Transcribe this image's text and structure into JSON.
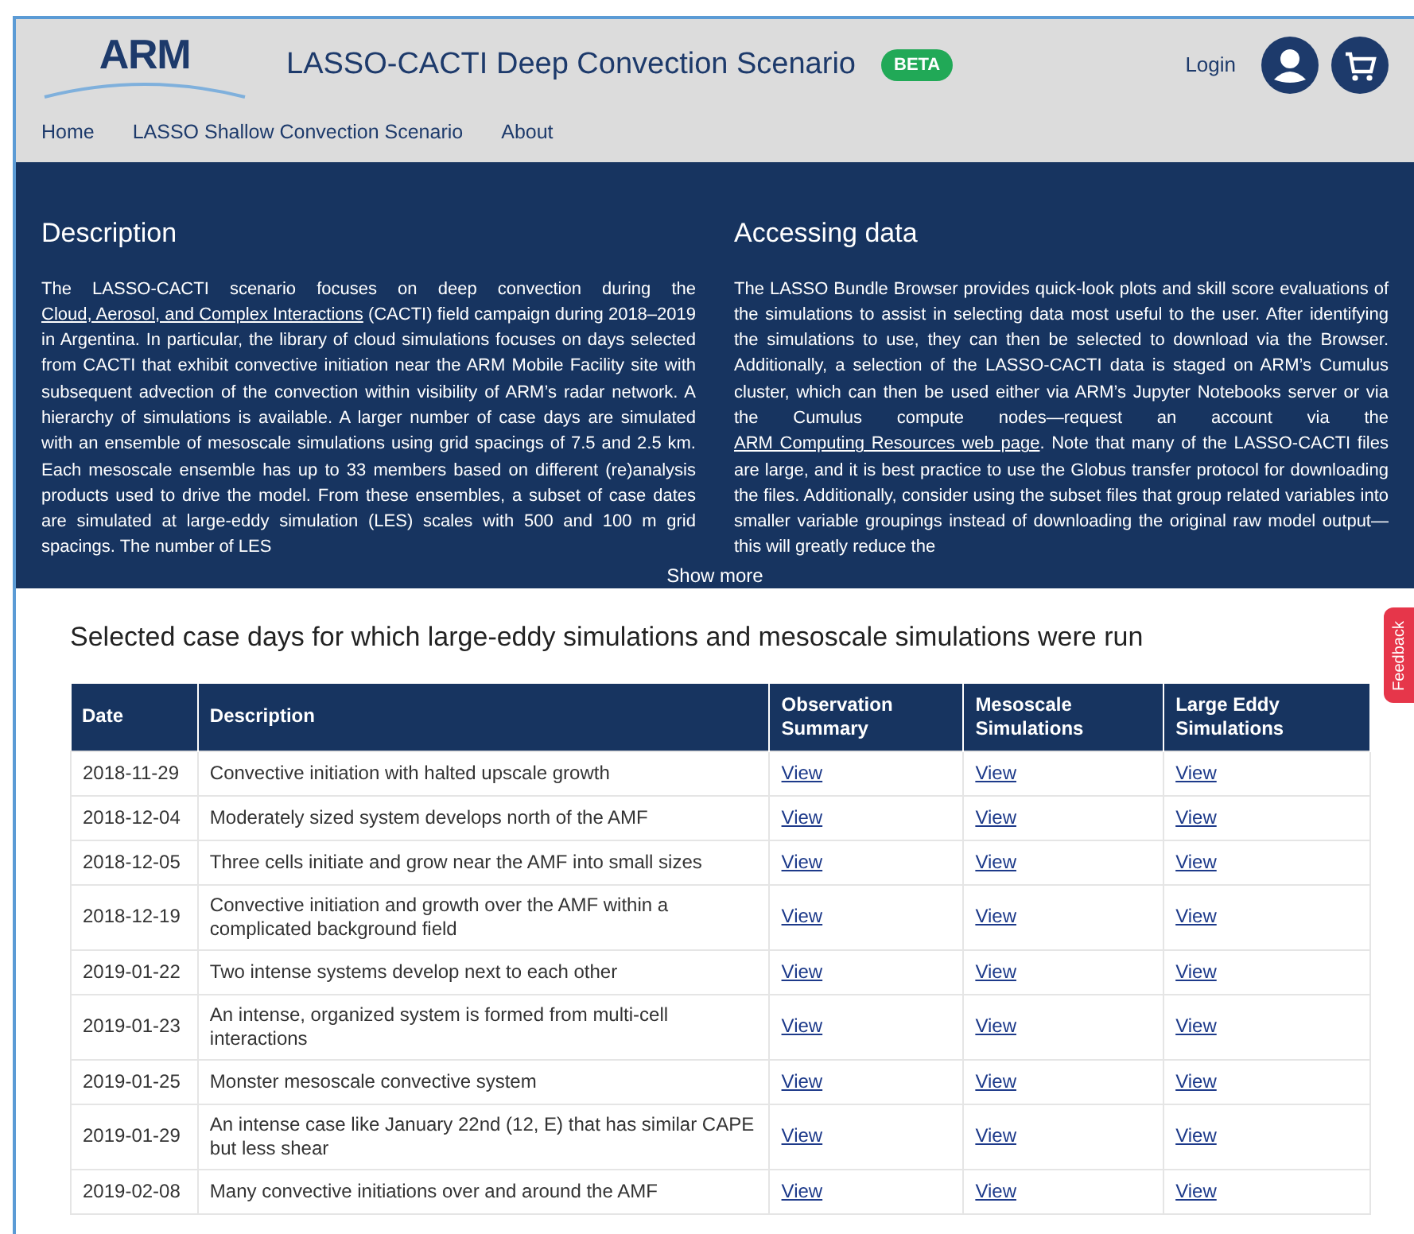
{
  "header": {
    "logo": "ARM",
    "title": "LASSO-CACTI Deep Convection Scenario",
    "badge": "BETA",
    "login": "Login"
  },
  "nav": [
    {
      "label": "Home"
    },
    {
      "label": "LASSO Shallow Convection Scenario"
    },
    {
      "label": "About"
    }
  ],
  "sections": [
    {
      "heading": "Description",
      "parts": [
        {
          "kind": "text",
          "text": "The LASSO-CACTI scenario focuses on deep convection during the"
        },
        {
          "kind": "link",
          "text": "Cloud, Aerosol, and Complex Interactions"
        },
        {
          "kind": "text",
          "text": "(CACTI) field campaign during 2018–2019 in Argentina. In particular, the library of cloud simulations focuses on days selected from CACTI that exhibit convective initiation near the ARM Mobile Facility site with subsequent advection of the convection within visibility of ARM’s radar network. A hierarchy of simulations is available. A larger number of case days are simulated with an ensemble of mesoscale simulations using grid spacings of 7.5 and 2.5 km. Each mesoscale ensemble has up to 33 members based on different (re)analysis products used to drive the model. From these ensembles, a subset of case dates are simulated at large-eddy simulation (LES) scales with 500 and 100 m grid spacings. The number of LES"
        }
      ]
    },
    {
      "heading": "Accessing data",
      "parts": [
        {
          "kind": "text",
          "text": "The LASSO Bundle Browser provides quick-look plots and skill score evaluations of the simulations to assist in selecting data most useful to the user. After identifying the simulations to use, they can then be selected to download via the Browser. Additionally, a selection of the LASSO-CACTI data is staged on ARM’s Cumulus cluster, which can then be used either via ARM’s Jupyter Notebooks server or via the Cumulus compute nodes—request an account via the"
        },
        {
          "kind": "link",
          "text": "ARM Computing Resources web page"
        },
        {
          "kind": "text",
          "text": ". Note that many of the LASSO-CACTI files are large, and it is best practice to use the Globus transfer protocol for downloading the files. Additionally, consider using the subset files that group related variables into smaller variable groupings instead of downloading the original raw model output—this will greatly reduce the"
        }
      ]
    }
  ],
  "show_more": "Show more",
  "feedback": "Feedback",
  "table": {
    "title": "Selected case days for which large-eddy simulations and mesoscale simulations were run",
    "columns": [
      "Date",
      "Description",
      "Observation Summary",
      "Mesoscale Simulations",
      "Large Eddy Simulations"
    ],
    "rows": [
      {
        "date": "2018-11-29",
        "description": "Convective initiation with halted upscale growth",
        "links": [
          "View",
          "View",
          "View"
        ]
      },
      {
        "date": "2018-12-04",
        "description": "Moderately sized system develops north of the AMF",
        "links": [
          "View",
          "View",
          "View"
        ]
      },
      {
        "date": "2018-12-05",
        "description": "Three cells initiate and grow near the AMF into small sizes",
        "links": [
          "View",
          "View",
          "View"
        ]
      },
      {
        "date": "2018-12-19",
        "description": "Convective initiation and growth over the AMF within a complicated background field",
        "links": [
          "View",
          "View",
          "View"
        ]
      },
      {
        "date": "2019-01-22",
        "description": "Two intense systems develop next to each other",
        "links": [
          "View",
          "View",
          "View"
        ]
      },
      {
        "date": "2019-01-23",
        "description": "An intense, organized system is formed from multi-cell interactions",
        "links": [
          "View",
          "View",
          "View"
        ]
      },
      {
        "date": "2019-01-25",
        "description": "Monster mesoscale convective system",
        "links": [
          "View",
          "View",
          "View"
        ]
      },
      {
        "date": "2019-01-29",
        "description": "An intense case like January 22nd (12, E) that has similar CAPE but less shear",
        "links": [
          "View",
          "View",
          "View"
        ]
      },
      {
        "date": "2019-02-08",
        "description": "Many convective initiations over and around the AMF",
        "links": [
          "View",
          "View",
          "View"
        ]
      }
    ]
  }
}
